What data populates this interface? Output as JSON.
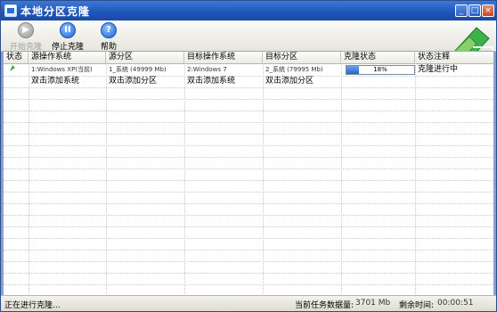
{
  "window": {
    "title": "本地分区克隆"
  },
  "toolbar": {
    "start_label": "开始克隆",
    "stop_label": "停止克隆",
    "help_label": "帮助",
    "help_glyph": "?"
  },
  "columns": [
    "状态",
    "源操作系统",
    "源分区",
    "目标操作系统",
    "目标分区",
    "克隆状态",
    "状态注释"
  ],
  "rows": [
    {
      "source_os": "1:Windows XP(当前)",
      "source_partition": "1_系统 (49999 Mb)",
      "target_os": "2:Windows 7",
      "target_partition": "2_系统 (79995 Mb)",
      "clone_progress": "18%",
      "note": "克隆进行中"
    },
    {
      "source_os": "双击添加系统",
      "source_partition": "双击添加分区",
      "target_os": "双击添加系统",
      "target_partition": "双击添加分区"
    }
  ],
  "statusbar": {
    "left": "正在进行克隆...",
    "task_label": "当前任务数据量:",
    "task_value": "3701 Mb",
    "remain_label": "剩余时间:",
    "remain_value": "00:00:51"
  },
  "colors": {
    "titlebar": "#1f55b8",
    "progress": "#2b63c8"
  },
  "progress_fraction": 0.18
}
